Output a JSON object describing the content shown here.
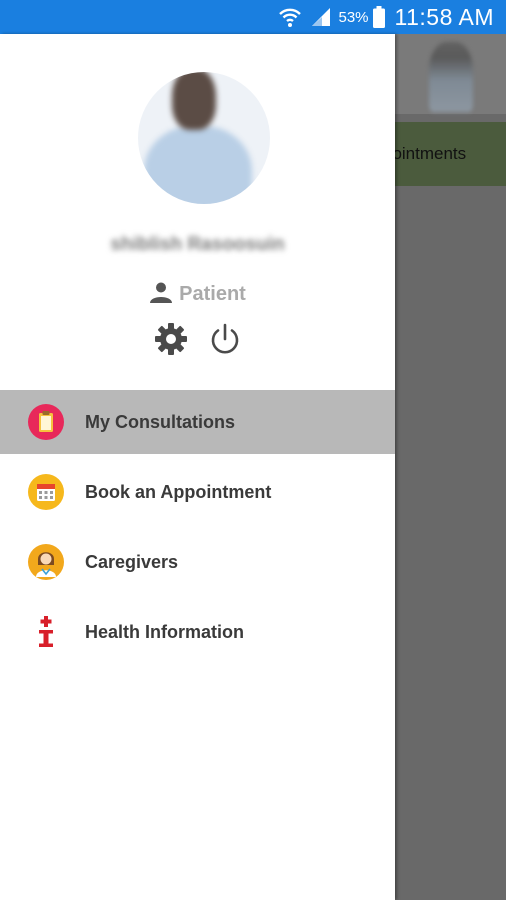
{
  "status_bar": {
    "battery_percent": "53%",
    "time": "11:58 AM",
    "background": "#1a7fe0"
  },
  "background_app": {
    "tab_label": "pointments"
  },
  "drawer": {
    "user": {
      "name": "shiblish Rasoosuin",
      "role": "Patient",
      "role_icon": "person-icon"
    },
    "actions": [
      {
        "name": "settings",
        "icon": "gear-icon"
      },
      {
        "name": "logout",
        "icon": "power-icon"
      }
    ],
    "menu": [
      {
        "label": "My Consultations",
        "icon": "clipboard-icon",
        "active": true
      },
      {
        "label": "Book an Appointment",
        "icon": "calendar-icon",
        "active": false
      },
      {
        "label": "Caregivers",
        "icon": "doctor-icon",
        "active": false
      },
      {
        "label": "Health Information",
        "icon": "medical-info-icon",
        "active": false
      }
    ]
  },
  "colors": {
    "active_item": "#b8b8b8",
    "overlay": "#6b6b6b"
  }
}
